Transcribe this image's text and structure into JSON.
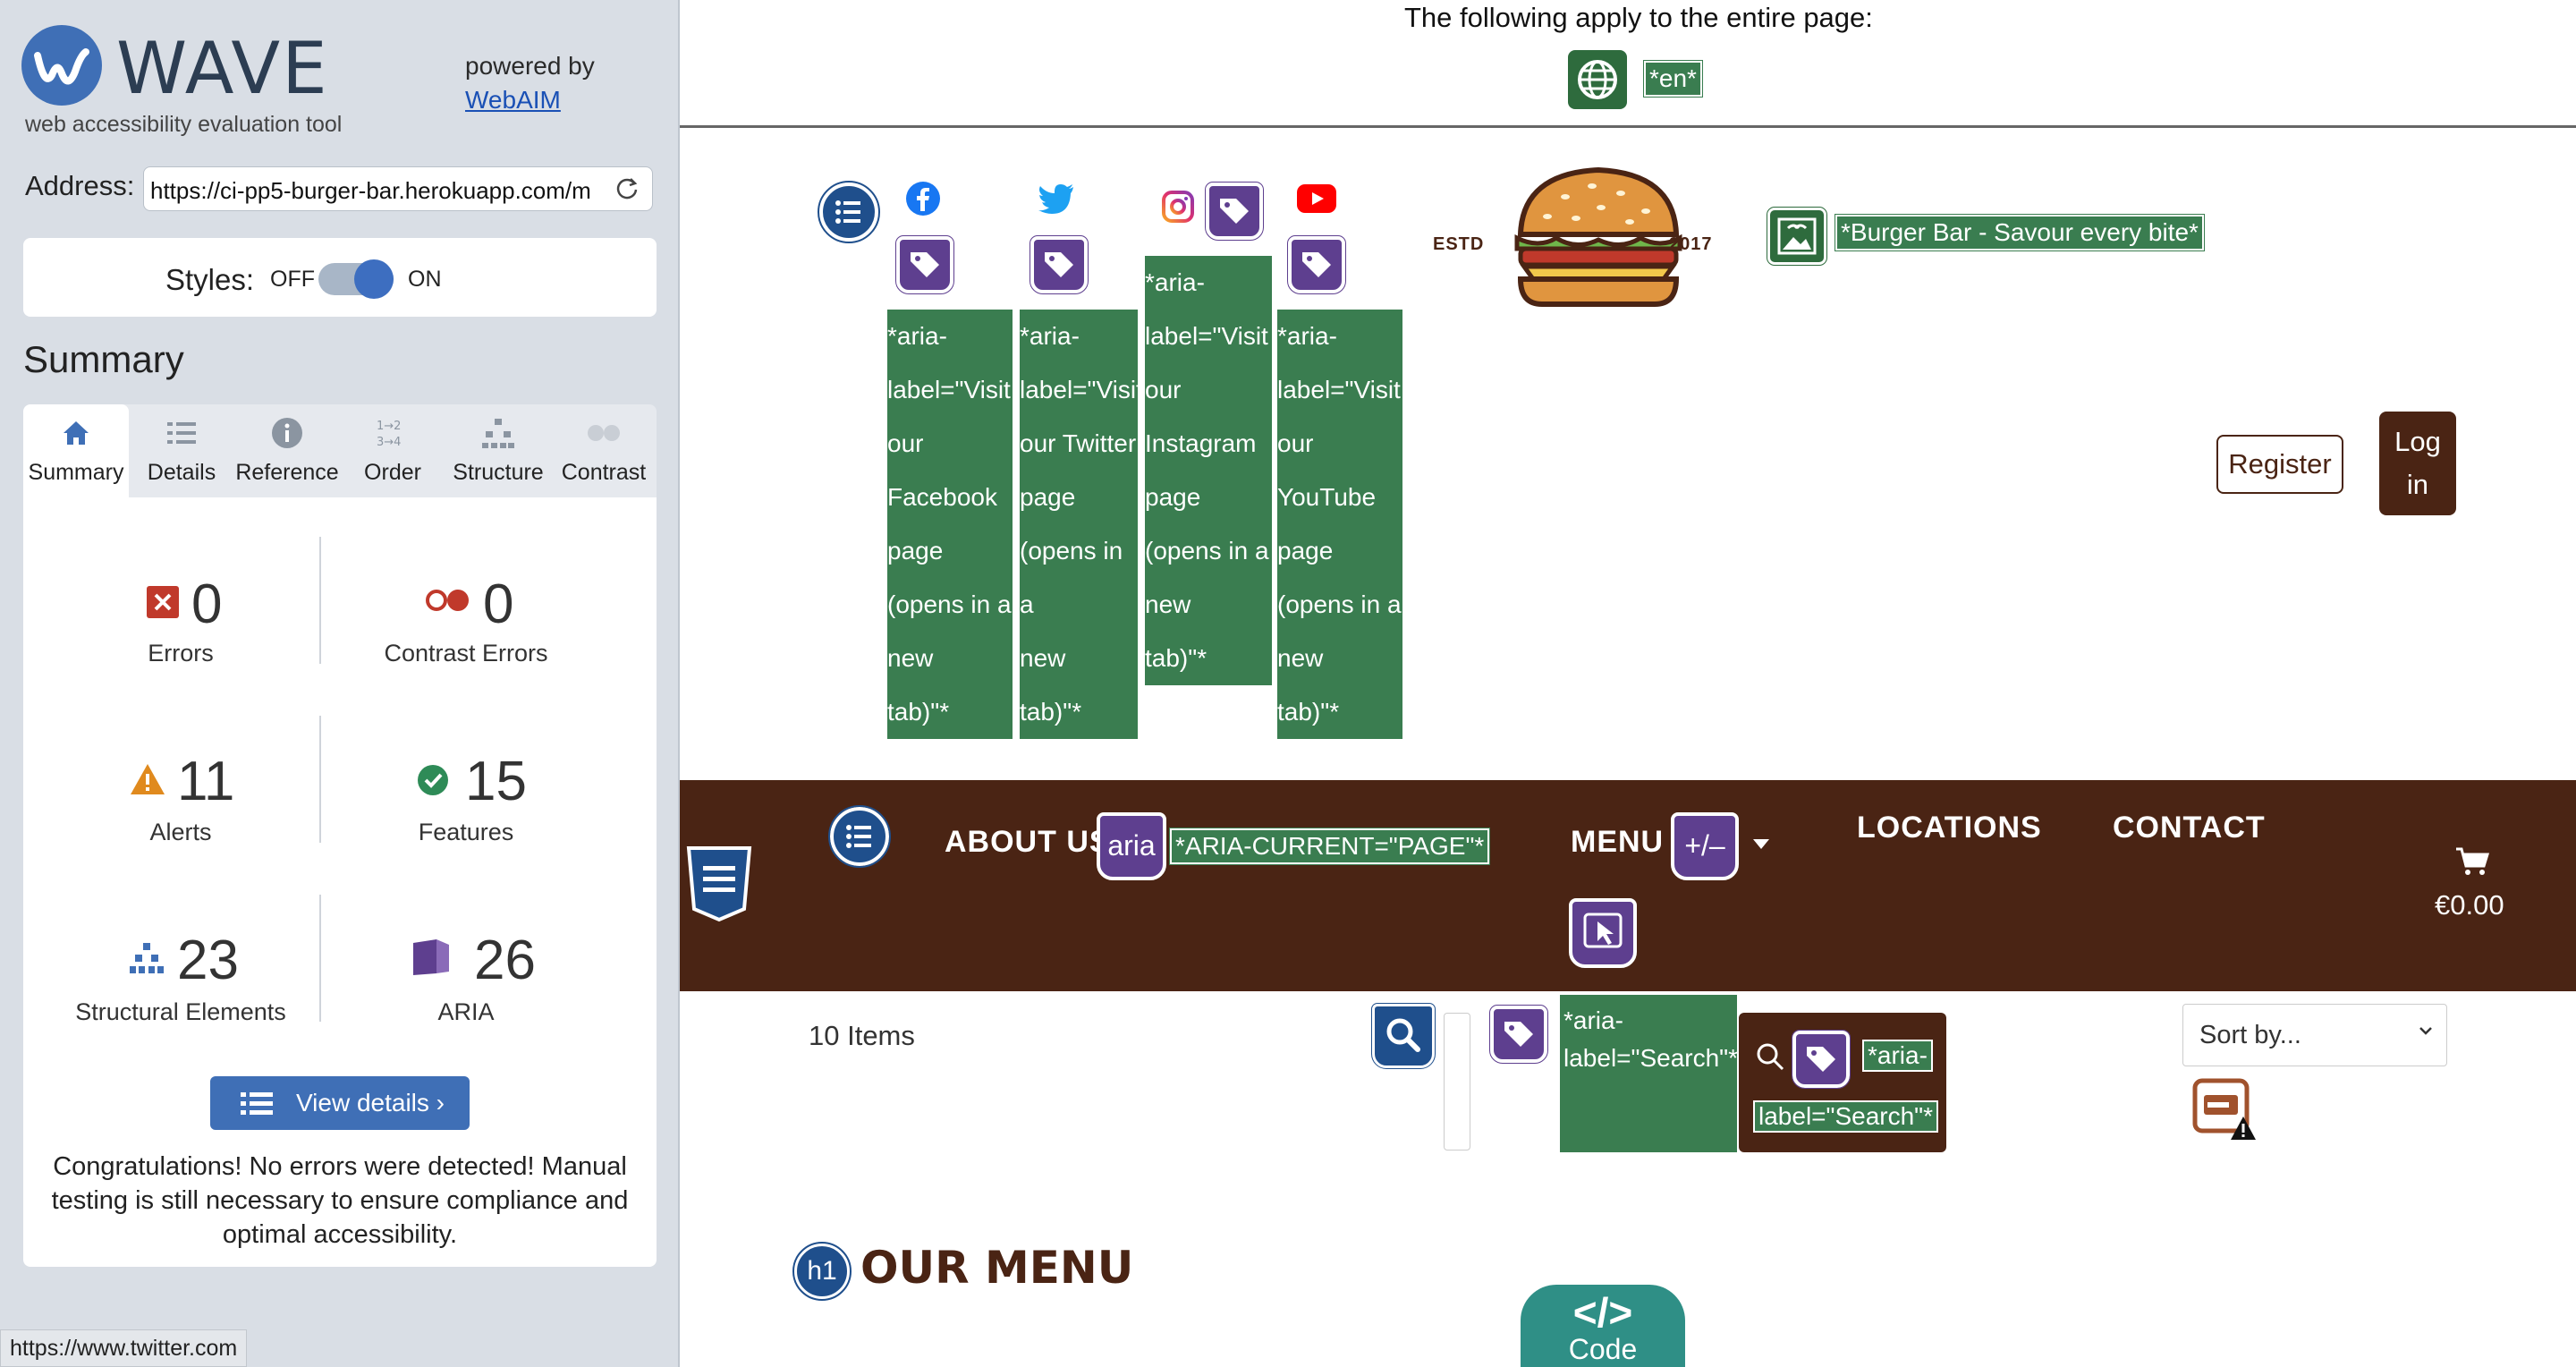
{
  "wave": {
    "logo_text": "WAVE",
    "tagline": "web accessibility evaluation tool",
    "powered_by": "powered by",
    "webaim_link": "WebAIM",
    "address_label": "Address:",
    "address_value": "https://ci-pp5-burger-bar.herokuapp.com/m",
    "styles_label": "Styles:",
    "styles_off": "OFF",
    "styles_on": "ON",
    "summary_title": "Summary",
    "tabs": [
      {
        "label": "Summary",
        "icon": "home-icon"
      },
      {
        "label": "Details",
        "icon": "list-icon"
      },
      {
        "label": "Reference",
        "icon": "info-icon"
      },
      {
        "label": "Order",
        "icon": "order-icon"
      },
      {
        "label": "Structure",
        "icon": "hierarchy-icon"
      },
      {
        "label": "Contrast",
        "icon": "contrast-icon"
      }
    ],
    "stats": {
      "errors": {
        "count": "0",
        "label": "Errors"
      },
      "contrast_errors": {
        "count": "0",
        "label": "Contrast Errors"
      },
      "alerts": {
        "count": "11",
        "label": "Alerts"
      },
      "features": {
        "count": "15",
        "label": "Features"
      },
      "structural": {
        "count": "23",
        "label": "Structural Elements"
      },
      "aria": {
        "count": "26",
        "label": "ARIA"
      }
    },
    "view_details_label": "View details ›",
    "congrats": "Congratulations! No errors were detected! Manual testing is still necessary to ensure compliance and optimal accessibility."
  },
  "status_url": "https://www.twitter.com",
  "page_note": {
    "text": "The following apply to the entire page:",
    "lang_tag": "*en*"
  },
  "social": {
    "facebook_label": [
      "*aria-",
      "label=\"Visit",
      "our",
      "Facebook",
      "page",
      "(opens in a",
      "new",
      "tab)\"*"
    ],
    "twitter_label": [
      "*aria-",
      "label=\"Visit",
      "our Twitter",
      "page",
      "(opens in a",
      "new",
      "tab)\"*"
    ],
    "instagram_label": [
      "*aria-",
      "label=\"Visit",
      "our",
      "Instagram",
      "page",
      "(opens in a",
      "new",
      "tab)\"*"
    ],
    "youtube_label": [
      "*aria-",
      "label=\"Visit",
      "our",
      "YouTube",
      "page",
      "(opens in a",
      "new",
      "tab)\"*"
    ]
  },
  "brand": {
    "estd": "ESTD",
    "year": "2017",
    "alt_tag": "*Burger Bar - Savour every bite*"
  },
  "auth": {
    "register": "Register",
    "login_line1": "Log",
    "login_line2": "in"
  },
  "nav": {
    "about": "ABOUT US",
    "aria_badge": "aria",
    "aria_current_tag": "*ARIA-CURRENT=\"PAGE\"*",
    "menu": "MENU",
    "plusminus_badge": "+/–",
    "locations": "LOCATIONS",
    "contact": "CONTACT",
    "cart_total": "€0.00"
  },
  "toolbar": {
    "items_count": "10 Items",
    "search_aria_1": "*aria-",
    "search_aria_2": "label=\"Search\"*",
    "search_btn_tag_1": "*aria-",
    "search_btn_tag_2": "label=\"Search\"*",
    "sort_placeholder": "Sort by..."
  },
  "main": {
    "h1_badge": "h1",
    "heading": "OUR MENU"
  },
  "code_button": {
    "glyph": "</>",
    "label": "Code"
  }
}
